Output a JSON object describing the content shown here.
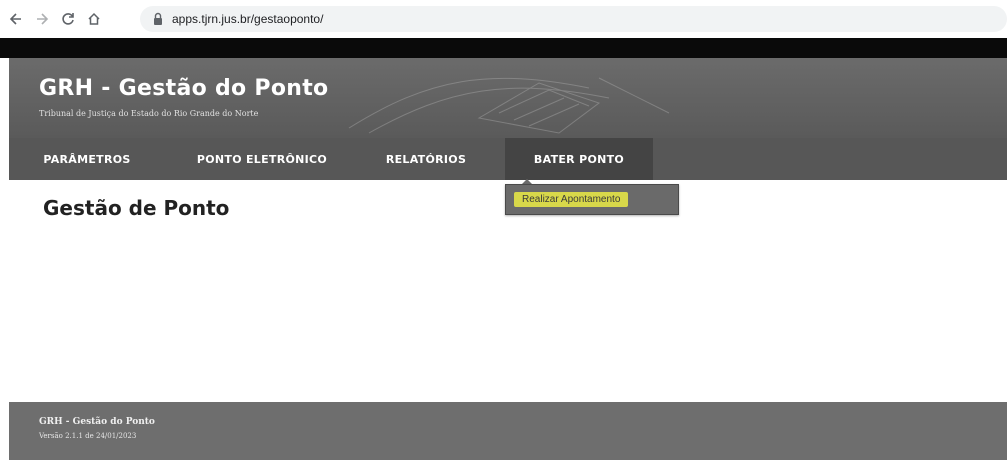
{
  "browser": {
    "url": "apps.tjrn.jus.br/gestaoponto/",
    "back_icon": "arrow-left-icon",
    "forward_icon": "arrow-right-icon",
    "reload_icon": "reload-icon",
    "home_icon": "home-icon",
    "lock_icon": "lock-icon"
  },
  "header": {
    "title": "GRH - Gestão do Ponto",
    "subtitle": "Tribunal de Justiça do Estado do Rio Grande do Norte"
  },
  "menu": {
    "items": [
      {
        "label": "PARÂMETROS"
      },
      {
        "label": "PONTO ELETRÔNICO"
      },
      {
        "label": "RELATÓRIOS"
      },
      {
        "label": "BATER PONTO"
      }
    ],
    "active_index": 3,
    "dropdown": {
      "items": [
        {
          "label": "Realizar Apontamento"
        }
      ]
    }
  },
  "main": {
    "page_title": "Gestão de Ponto"
  },
  "footer": {
    "title": "GRH - Gestão do Ponto",
    "version": "Versão 2.1.1 de 24/01/2023"
  },
  "colors": {
    "header_bg": "#5f5f5f",
    "menu_bg": "#575757",
    "menu_active_bg": "#444444",
    "highlight": "#d8d84a",
    "footer_bg": "#6e6e6e"
  }
}
